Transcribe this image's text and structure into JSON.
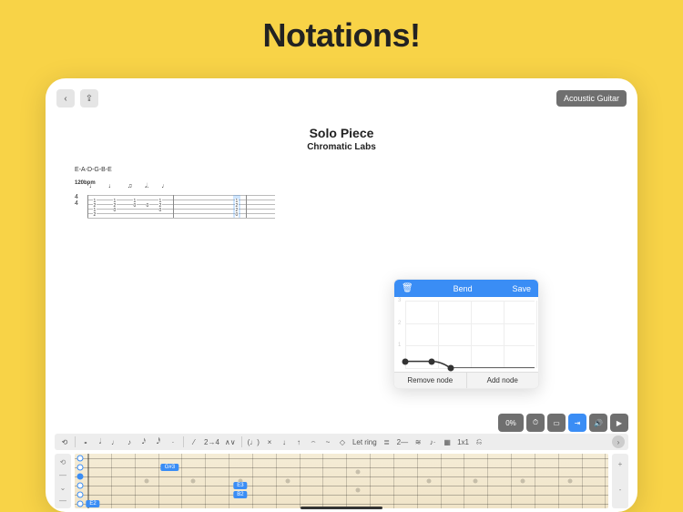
{
  "promo": {
    "title": "Notations!"
  },
  "toolbar": {
    "back_icon": "‹",
    "share_icon": "⇪",
    "instrument_label": "Acoustic Guitar"
  },
  "piece": {
    "title": "Solo Piece",
    "subtitle": "Chromatic Labs",
    "tuning": "E-A-D-G-B-E",
    "tempo": "120bpm",
    "time_signature": {
      "top": "4",
      "bottom": "4"
    }
  },
  "chart_data": {
    "type": "line",
    "title": "Bend",
    "xlabel": "",
    "ylabel": "",
    "ylim": [
      0,
      3
    ],
    "yticks": [
      1,
      2,
      3
    ],
    "x": [
      0.0,
      0.2,
      0.35,
      1.0
    ],
    "values": [
      0.3,
      0.3,
      0.0,
      0.0
    ],
    "nodes": [
      {
        "x": 0.0,
        "y": 0.3
      },
      {
        "x": 0.2,
        "y": 0.3
      },
      {
        "x": 0.35,
        "y": 0.0
      }
    ]
  },
  "bend": {
    "title": "Bend",
    "save_label": "Save",
    "remove_node_label": "Remove node",
    "add_node_label": "Add node"
  },
  "controls": {
    "zoom_label": "0%",
    "clock_icon": "⏱",
    "metronome_icon": "▭",
    "mode_label": "⇥",
    "volume_icon": "🔊",
    "play_icon": "▶"
  },
  "note_toolbar": {
    "items": [
      "⟲",
      "|",
      "𝅝",
      "𝅗𝅥",
      "♩",
      "♪",
      "𝅘𝅥𝅯",
      "𝅘𝅥𝅰",
      "·",
      "|",
      "⁄",
      "2→4",
      "∧∨",
      "|",
      "(♩)",
      "×",
      "↓",
      "↑",
      "⌢",
      "~",
      "◇",
      "Let ring",
      "≣",
      "2—",
      "≋",
      "♪·",
      "▦",
      "1x1",
      "⎌"
    ],
    "chevron": "›"
  },
  "fretboard": {
    "strings": 6,
    "frets_visible": 22,
    "left_side": [
      "⟲",
      "—",
      "⌄",
      "—"
    ],
    "right_side": [
      "+",
      "",
      "-",
      ""
    ],
    "markers_single": [
      3,
      5,
      7,
      9,
      15,
      17,
      19,
      21
    ],
    "markers_double": [
      12
    ],
    "notes": [
      {
        "string": 2,
        "fret": 4,
        "label": "G#3"
      },
      {
        "string": 4,
        "fret": 7,
        "label": "E3"
      },
      {
        "string": 5,
        "fret": 7,
        "label": "B2"
      },
      {
        "string": 6,
        "fret": 0,
        "label": "E2"
      }
    ],
    "open_indicators": [
      {
        "string": 1,
        "filled": false
      },
      {
        "string": 2,
        "filled": false
      },
      {
        "string": 3,
        "filled": true
      },
      {
        "string": 4,
        "filled": false
      },
      {
        "string": 5,
        "filled": false
      },
      {
        "string": 6,
        "filled": false
      }
    ]
  }
}
